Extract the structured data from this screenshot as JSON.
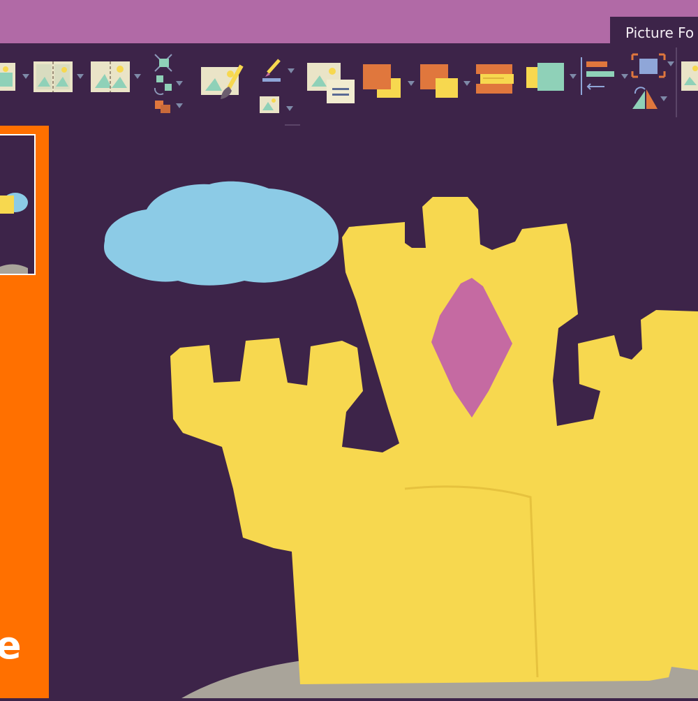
{
  "ribbon": {
    "contextual_tab_label": "Picture Fo"
  },
  "slides_panel": {
    "partial_letter": "e"
  },
  "colors": {
    "title_bar": "#b16aa6",
    "background": "#3d2449",
    "slides_panel": "#ff7000",
    "castle": "#f7d84f",
    "cloud": "#8ccbe6",
    "gem": "#c56aa2",
    "ground": "#a9a49a"
  },
  "icons": [
    "picture-corrections-icon",
    "picture-color-icon",
    "picture-effects-icon",
    "compress-pictures-icon",
    "artistic-effects-icon",
    "change-picture-icon",
    "reset-picture-icon",
    "picture-layout-icon",
    "bring-forward-icon",
    "send-backward-icon",
    "selection-pane-icon",
    "group-icon",
    "align-icon",
    "crop-icon",
    "rotate-icon",
    "picture-styles-icon"
  ]
}
